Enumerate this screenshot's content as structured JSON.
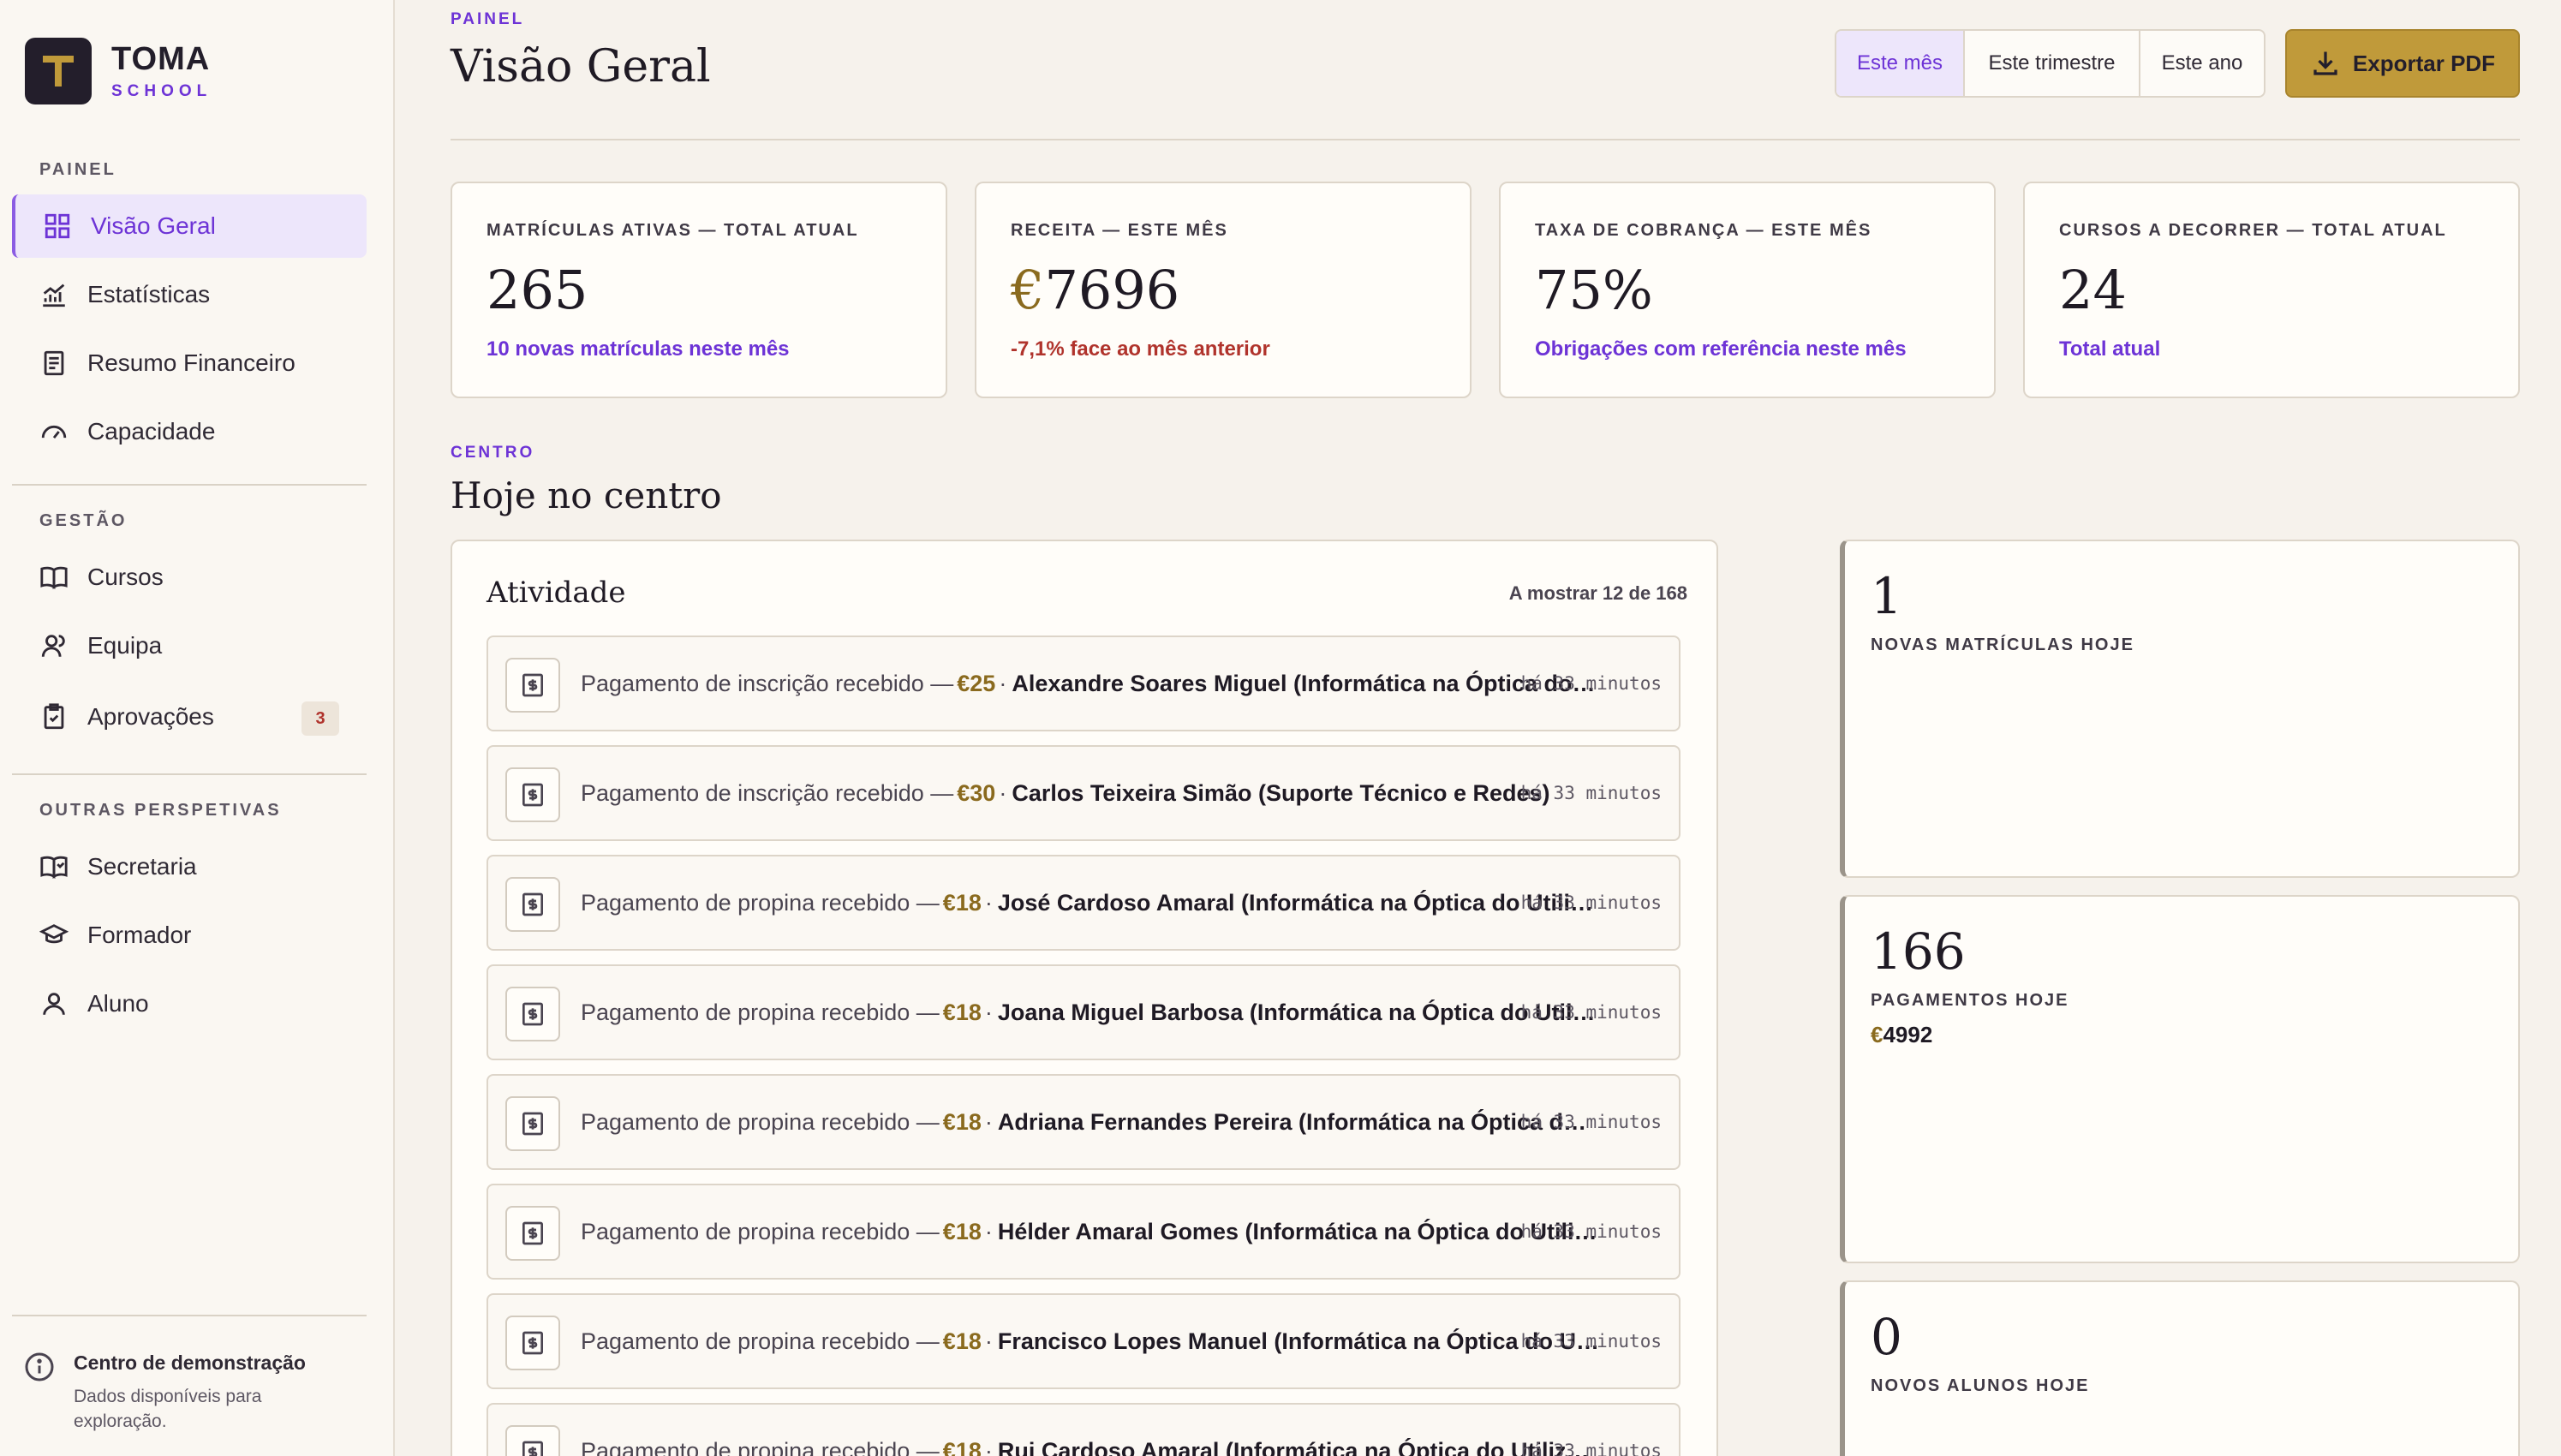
{
  "brand": {
    "name": "TOMA",
    "sub": "SCHOOL",
    "letter": "T"
  },
  "sidebar": {
    "sections": [
      {
        "title": "PAINEL",
        "items": [
          {
            "label": "Visão Geral",
            "icon": "grid-icon"
          },
          {
            "label": "Estatísticas",
            "icon": "chart-icon"
          },
          {
            "label": "Resumo Financeiro",
            "icon": "document-icon"
          },
          {
            "label": "Capacidade",
            "icon": "gauge-icon"
          }
        ]
      },
      {
        "title": "GESTÃO",
        "items": [
          {
            "label": "Cursos",
            "icon": "book-icon"
          },
          {
            "label": "Equipa",
            "icon": "users-icon"
          },
          {
            "label": "Aprovações",
            "icon": "clipboard-check-icon",
            "badge": "3"
          }
        ]
      },
      {
        "title": "OUTRAS PERSPETIVAS",
        "items": [
          {
            "label": "Secretaria",
            "icon": "book-open-icon"
          },
          {
            "label": "Formador",
            "icon": "graduation-cap-icon"
          },
          {
            "label": "Aluno",
            "icon": "user-icon"
          }
        ]
      }
    ],
    "demo": {
      "title": "Centro de demonstração",
      "subtitle": "Dados disponíveis para exploração."
    }
  },
  "header": {
    "eyebrow": "PAINEL",
    "title": "Visão Geral",
    "periods": [
      "Este mês",
      "Este trimestre",
      "Este ano"
    ],
    "active_period": "Este mês",
    "export_label": "Exportar PDF"
  },
  "kpis": [
    {
      "label": "MATRÍCULAS ATIVAS — TOTAL ATUAL",
      "currency": "",
      "value": "265",
      "note": "10 novas matrículas neste mês",
      "negative": false
    },
    {
      "label": "RECEITA — ESTE MÊS",
      "currency": "€",
      "value": "7696",
      "note": "-7,1% face ao mês anterior",
      "negative": true
    },
    {
      "label": "TAXA DE COBRANÇA — ESTE MÊS",
      "currency": "",
      "value": "75%",
      "note": "Obrigações com referência neste mês",
      "negative": false
    },
    {
      "label": "CURSOS A DECORRER — TOTAL ATUAL",
      "currency": "",
      "value": "24",
      "note": "Total atual",
      "negative": false
    }
  ],
  "centro": {
    "eyebrow": "CENTRO",
    "title": "Hoje no centro",
    "activity": {
      "title": "Atividade",
      "count": "A mostrar 12 de 168",
      "items": [
        {
          "text": "Pagamento de inscrição recebido —",
          "currency": "€",
          "amount": "25",
          "who": "Alexandre Soares Miguel (Informática na Óptica do Utilizador)",
          "time": "há 33 minutos"
        },
        {
          "text": "Pagamento de inscrição recebido —",
          "currency": "€",
          "amount": "30",
          "who": "Carlos Teixeira Simão (Suporte Técnico e Redes)",
          "time": "há 33 minutos"
        },
        {
          "text": "Pagamento de propina recebido —",
          "currency": "€",
          "amount": "18",
          "who": "José Cardoso Amaral (Informática na Óptica do Utilizador)",
          "time": "há 33 minutos"
        },
        {
          "text": "Pagamento de propina recebido —",
          "currency": "€",
          "amount": "18",
          "who": "Joana Miguel Barbosa (Informática na Óptica do Utilizador)",
          "time": "há 33 minutos"
        },
        {
          "text": "Pagamento de propina recebido —",
          "currency": "€",
          "amount": "18",
          "who": "Adriana Fernandes Pereira (Informática na Óptica do Utilizador)",
          "time": "há 33 minutos"
        },
        {
          "text": "Pagamento de propina recebido —",
          "currency": "€",
          "amount": "18",
          "who": "Hélder Amaral Gomes (Informática na Óptica do Utilizador)",
          "time": "há 33 minutos"
        },
        {
          "text": "Pagamento de propina recebido —",
          "currency": "€",
          "amount": "18",
          "who": "Francisco Lopes Manuel (Informática na Óptica do Utilizador)",
          "time": "há 33 minutos"
        },
        {
          "text": "Pagamento de propina recebido —",
          "currency": "€",
          "amount": "18",
          "who": "Rui Cardoso Amaral (Informática na Óptica do Utilizador)",
          "time": "há 33 minutos"
        }
      ]
    },
    "stats": [
      {
        "number": "1",
        "label": "NOVAS MATRÍCULAS HOJE"
      },
      {
        "number": "166",
        "label": "PAGAMENTOS HOJE",
        "currency": "€",
        "extra": "4992"
      },
      {
        "number": "0",
        "label": "NOVOS ALUNOS HOJE"
      }
    ]
  },
  "colors": {
    "accent": "#6d33d6",
    "gold": "#c09a3a",
    "negative": "#b0332c",
    "background": "#f6f2ec"
  }
}
